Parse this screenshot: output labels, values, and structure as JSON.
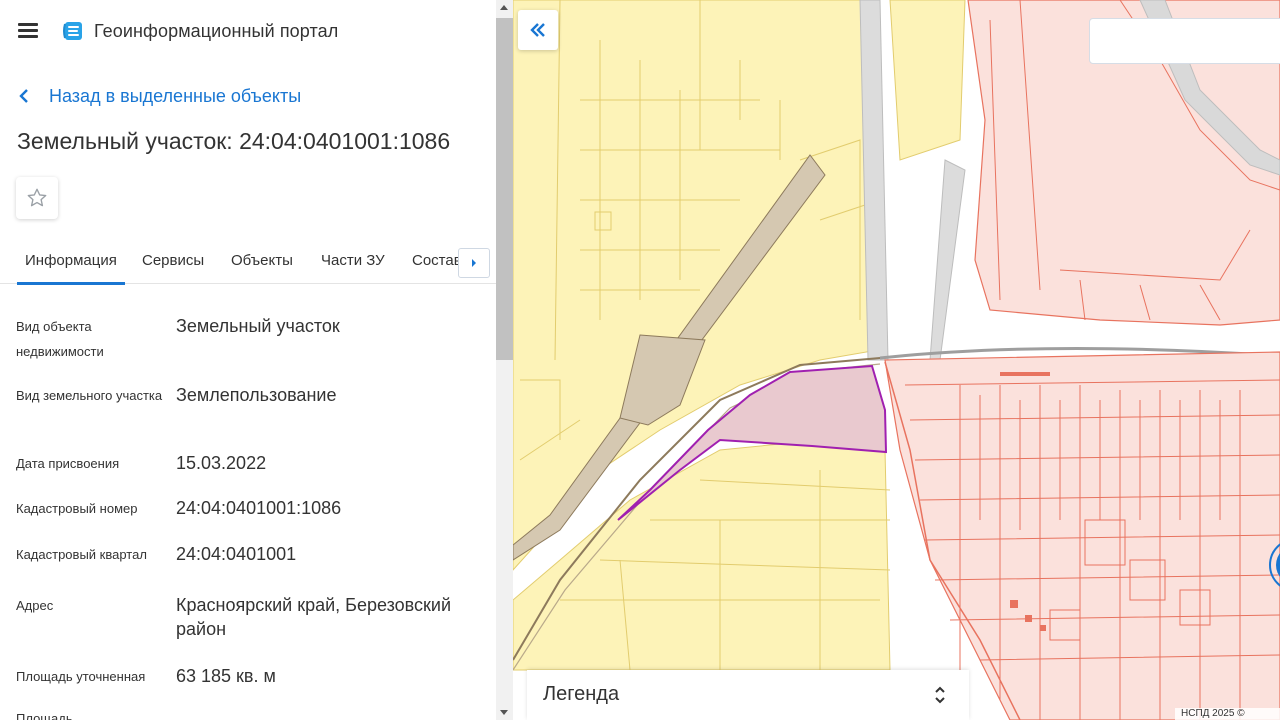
{
  "app": {
    "title": "Геоинформационный портал",
    "accent_color": "#1976d2",
    "icons": {
      "menu": "hamburger-icon",
      "logo": "portal-logo-icon"
    }
  },
  "nav": {
    "back_label": "Назад в выделенные объекты"
  },
  "object": {
    "title": "Земельный участок: 24:04:0401001:1086",
    "favorite_icon": "star-outline-icon"
  },
  "tabs": [
    {
      "label": "Информация",
      "active": true
    },
    {
      "label": "Сервисы",
      "active": false
    },
    {
      "label": "Объекты",
      "active": false
    },
    {
      "label": "Части ЗУ",
      "active": false
    },
    {
      "label": "Состав",
      "active": false
    }
  ],
  "info": [
    {
      "label": "Вид объекта недвижимости",
      "value": "Земельный участок"
    },
    {
      "label": "Вид земельного участка",
      "value": "Землепользование"
    },
    {
      "label": "Дата присвоения",
      "value": "15.03.2022"
    },
    {
      "label": "Кадастровый номер",
      "value": "24:04:0401001:1086"
    },
    {
      "label": "Кадастровый квартал",
      "value": "24:04:0401001"
    },
    {
      "label": "Адрес",
      "value": "Красноярский край, Березовский район"
    },
    {
      "label": "Площадь уточненная",
      "value": "63 185 кв. м"
    },
    {
      "label": "Площадь",
      "value": ""
    }
  ],
  "map": {
    "legend_label": "Легенда",
    "attribution": "НСПД 2025 ©",
    "colors": {
      "parcel_yellow": "#fdf3b8",
      "parcel_yellow_border": "#e2cc6e",
      "parcel_red": "#fbe1dc",
      "parcel_red_border": "#e8735f",
      "selected_fill": "#e9c9cf",
      "selected_border": "#a020b0",
      "road_brown": "#d5c8b1"
    }
  }
}
